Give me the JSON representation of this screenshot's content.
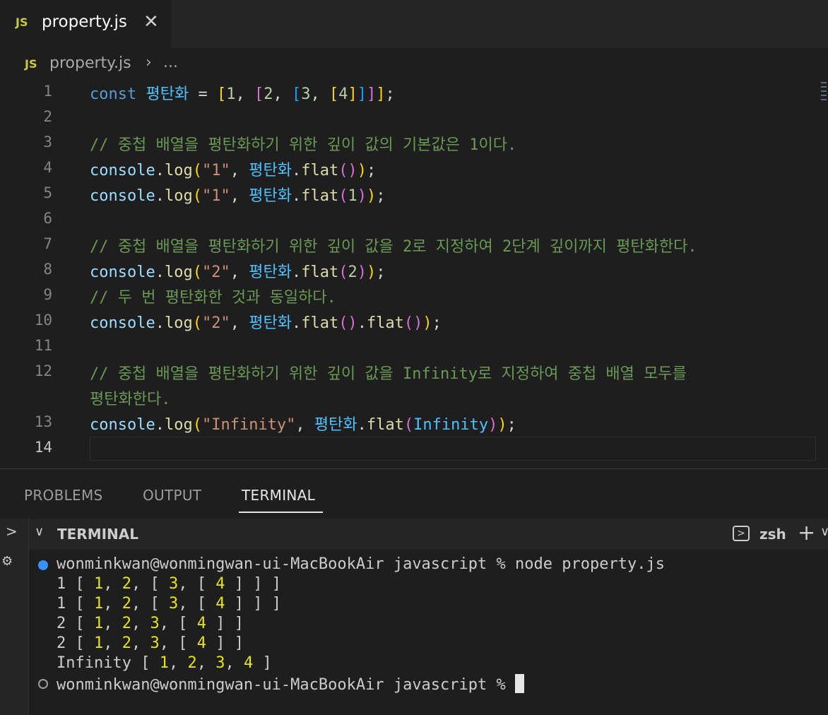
{
  "tab": {
    "badge": "JS",
    "title": "property.js",
    "close": "✕"
  },
  "breadcrumb": {
    "badge": "JS",
    "file": "property.js",
    "separator": "›",
    "more": "..."
  },
  "editor": {
    "line_numbers": [
      "1",
      "2",
      "3",
      "4",
      "5",
      "6",
      "7",
      "8",
      "9",
      "10",
      "11",
      "12",
      "13",
      "14"
    ],
    "line1": {
      "kw": "const",
      "var": "평탄화",
      "eq": " = ",
      "b1o": "[",
      "n1": "1",
      "c1": ", ",
      "b2o": "[",
      "n2": "2",
      "c2": ", ",
      "b3o": "[",
      "n3": "3",
      "c3": ", ",
      "b1o2": "[",
      "n4": "4",
      "close": "]]]]",
      "semi": ";"
    },
    "line3": "// 중첩 배열을 평탄화하기 위한 깊이 값의 기본값은 1이다.",
    "line4": {
      "obj": "console",
      "dot": ".",
      "fn": "log",
      "po": "(",
      "str": "\"1\"",
      "comma": ", ",
      "var": "평탄화",
      "dot2": ".",
      "fn2": "flat",
      "args": "()",
      "pc": ")",
      "semi": ";"
    },
    "line5": {
      "obj": "console",
      "dot": ".",
      "fn": "log",
      "po": "(",
      "str": "\"1\"",
      "comma": ", ",
      "var": "평탄화",
      "dot2": ".",
      "fn2": "flat",
      "ao": "(",
      "arg": "1",
      "ac": ")",
      "pc": ")",
      "semi": ";"
    },
    "line7": "// 중첩 배열을 평탄화하기 위한 깊이 값을 2로 지정하여 2단계 깊이까지 평탄화한다.",
    "line8": {
      "obj": "console",
      "dot": ".",
      "fn": "log",
      "po": "(",
      "str": "\"2\"",
      "comma": ", ",
      "var": "평탄화",
      "dot2": ".",
      "fn2": "flat",
      "ao": "(",
      "arg": "2",
      "ac": ")",
      "pc": ")",
      "semi": ";"
    },
    "line9": "// 두 번 평탄화한 것과 동일하다.",
    "line10": {
      "obj": "console",
      "dot": ".",
      "fn": "log",
      "po": "(",
      "str": "\"2\"",
      "comma": ", ",
      "var": "평탄화",
      "dot2": ".",
      "fn2": "flat",
      "args": "()",
      "dot3": ".",
      "fn3": "flat",
      "args2": "()",
      "pc": ")",
      "semi": ";"
    },
    "line12a": "// 중첩 배열을 평탄화하기 위한 깊이 값을 Infinity로 지정하여 중첩 배열 모두를",
    "line12b": "평탄화한다.",
    "line13": {
      "obj": "console",
      "dot": ".",
      "fn": "log",
      "po": "(",
      "str": "\"Infinity\"",
      "comma": ", ",
      "var": "평탄화",
      "dot2": ".",
      "fn2": "flat",
      "ao": "(",
      "arg": "Infinity",
      "ac": ")",
      "pc": ")",
      "semi": ";"
    }
  },
  "panel": {
    "tabs": [
      "PROBLEMS",
      "OUTPUT",
      "TERMINAL"
    ],
    "active_tab": "TERMINAL"
  },
  "terminal": {
    "header_title": "TERMINAL",
    "shell": "zsh",
    "prompt1": "wonminkwan@wonmingwan-ui-MacBookAir javascript % node property.js",
    "output": [
      {
        "label": "1 ",
        "parts": [
          "[ ",
          "1",
          ", ",
          "2",
          ", [ ",
          "3",
          ", [ ",
          "4",
          " ] ] ]"
        ]
      },
      {
        "label": "1 ",
        "parts": [
          "[ ",
          "1",
          ", ",
          "2",
          ", [ ",
          "3",
          ", [ ",
          "4",
          " ] ] ]"
        ]
      },
      {
        "label": "2 ",
        "parts": [
          "[ ",
          "1",
          ", ",
          "2",
          ", ",
          "3",
          ", [ ",
          "4",
          " ] ]"
        ]
      },
      {
        "label": "2 ",
        "parts": [
          "[ ",
          "1",
          ", ",
          "2",
          ", ",
          "3",
          ", [ ",
          "4",
          " ] ]"
        ]
      },
      {
        "label": "Infinity ",
        "parts": [
          "[ ",
          "1",
          ", ",
          "2",
          ", ",
          "3",
          ", ",
          "4",
          " ]"
        ]
      }
    ],
    "prompt2": "wonminkwan@wonmingwan-ui-MacBookAir javascript % "
  },
  "colors": {
    "accent_blue": "#3794ff",
    "number_yellow": "#e5e510",
    "js_badge": "#cbcb41"
  }
}
